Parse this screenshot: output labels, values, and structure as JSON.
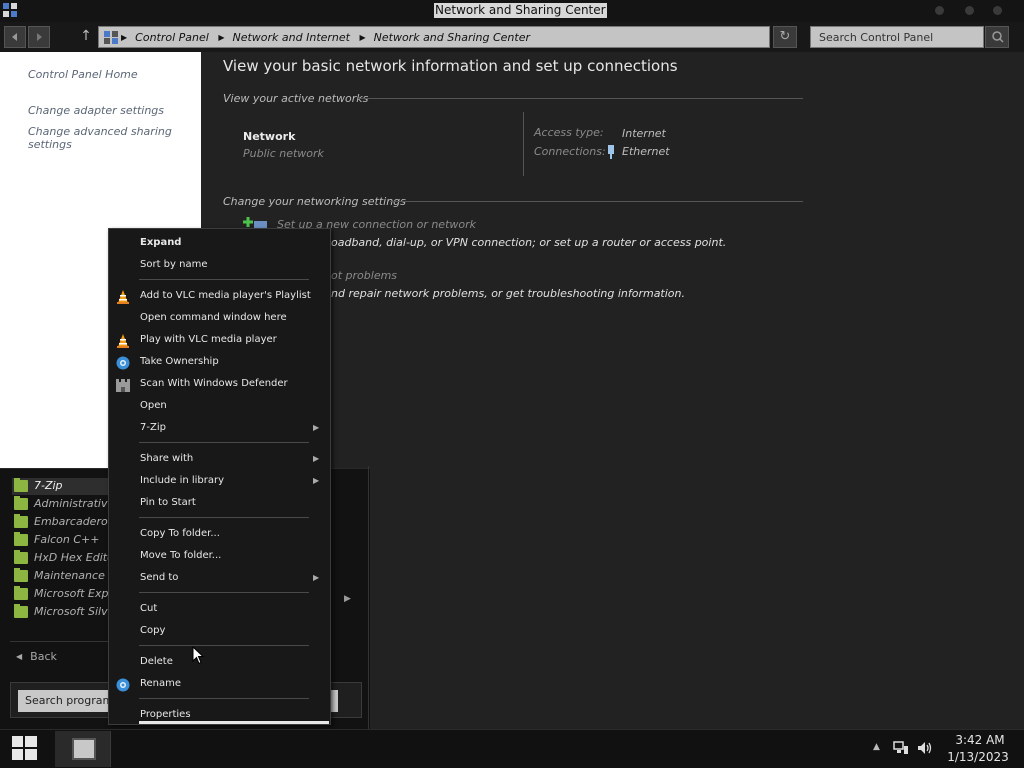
{
  "window": {
    "title": "Network and Sharing Center",
    "icon": "control-panel-icon"
  },
  "address": {
    "crumbs": [
      "Control Panel",
      "Network and Internet",
      "Network and Sharing Center"
    ],
    "search_placeholder": "Search Control Panel"
  },
  "leftpane": {
    "home": "Control Panel Home",
    "links": [
      "Change adapter settings",
      "Change advanced sharing settings"
    ]
  },
  "main": {
    "heading": "View your basic network information and set up connections",
    "active_networks_label": "View your active networks",
    "network_name": "Network",
    "network_type": "Public network",
    "access_type_label": "Access type:",
    "access_type_value": "Internet",
    "connections_label": "Connections:",
    "connections_value": "Ethernet",
    "change_settings_label": "Change your networking settings",
    "task1_title": "Set up a new connection or network",
    "task1_desc": "oadband, dial-up, or VPN connection; or set up a router or access point.",
    "task2_title": "ot problems",
    "task2_desc": "nd repair network problems, or get troubleshooting information."
  },
  "startmenu": {
    "items": [
      "7-Zip",
      "Administrative",
      "Embarcadero D",
      "Falcon C++",
      "HxD Hex Editor",
      "Maintenance",
      "Microsoft Expre",
      "Microsoft Silve"
    ],
    "back": "Back",
    "search_placeholder": "Search program"
  },
  "context_menu": {
    "items": [
      {
        "label": "Expand",
        "bold": true
      },
      {
        "label": "Sort by name"
      },
      {
        "label": "Add to VLC media player's Playlist",
        "icon": "vlc-cone-icon"
      },
      {
        "label": "Open command window here"
      },
      {
        "label": "Play with VLC media player",
        "icon": "vlc-cone-icon"
      },
      {
        "label": "Take Ownership",
        "icon": "gear-shield-icon"
      },
      {
        "label": "Scan With Windows Defender",
        "icon": "defender-castle-icon"
      },
      {
        "label": "Open"
      },
      {
        "label": "7-Zip",
        "submenu": true
      },
      {
        "label": "Share with",
        "submenu": true
      },
      {
        "label": "Include in library",
        "submenu": true
      },
      {
        "label": "Pin to Start"
      },
      {
        "label": "Copy To folder..."
      },
      {
        "label": "Move To folder..."
      },
      {
        "label": "Send to",
        "submenu": true
      },
      {
        "label": "Cut"
      },
      {
        "label": "Copy"
      },
      {
        "label": "Delete"
      },
      {
        "label": "Rename",
        "icon": "gear-shield-icon"
      },
      {
        "label": "Properties"
      }
    ]
  },
  "taskbar": {
    "time": "3:42 AM",
    "date": "1/13/2023"
  },
  "colors": {
    "accent_folder": "#8db542",
    "vlc_orange": "#f39c12",
    "gear_blue": "#3a8fd8"
  }
}
